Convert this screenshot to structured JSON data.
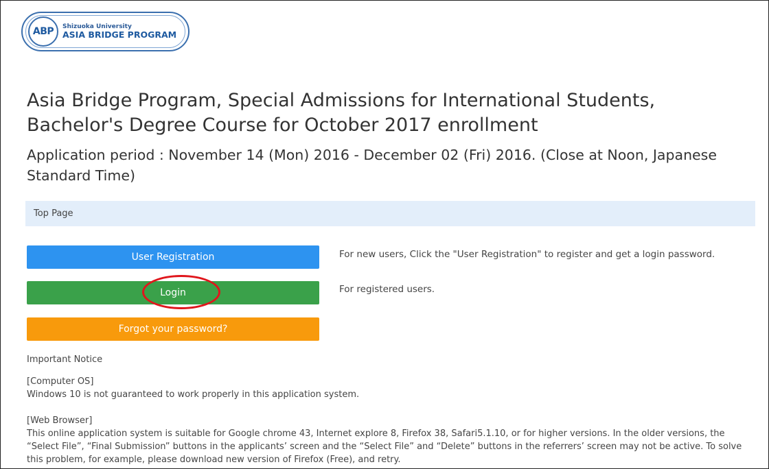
{
  "logo": {
    "mark": "ABP",
    "subtitle": "Shizuoka University",
    "name": "ASIA BRIDGE PROGRAM"
  },
  "page": {
    "title": "Asia Bridge Program, Special Admissions for International Students, Bachelor's Degree Course for October 2017 enrollment",
    "period": "Application period : November 14 (Mon) 2016 - December 02 (Fri) 2016. (Close at Noon, Japanese Standard Time)"
  },
  "breadcrumb": {
    "label": "Top Page"
  },
  "buttons": {
    "register": "User Registration",
    "login": "Login",
    "forgot": "Forgot your password?"
  },
  "help": {
    "register": "For new users, Click the \"User Registration\" to register and get a login password.",
    "login": "For registered users."
  },
  "notice": {
    "title": "Important Notice",
    "os_heading": "[Computer OS]",
    "os_text": "Windows 10 is not guaranteed to work properly in this application system.",
    "web_heading": "[Web Browser]",
    "web_text": "This online application system is suitable for Google chrome 43, Internet explore 8, Firefox 38, Safari5.1.10, or for higher versions. In the older versions, the “Select File”, “Final Submission” buttons in the applicants’ screen and the “Select File” and “Delete” buttons in the referrers’ screen may not be active. To solve this problem, for example, please download new version of Firefox (Free), and retry."
  },
  "colors": {
    "register_button": "#2d93f0",
    "login_button": "#3aa14a",
    "forgot_button": "#f89a0c",
    "breadcrumb_bg": "#e3eefa",
    "highlight_circle": "#e0161c"
  }
}
